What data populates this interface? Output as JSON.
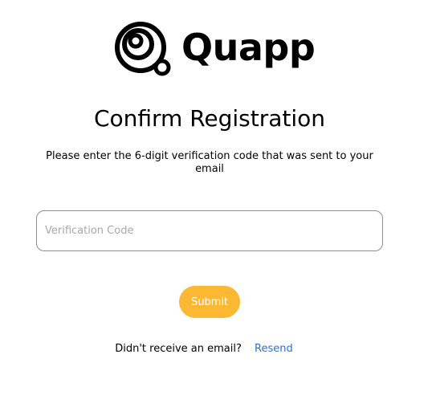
{
  "brand": {
    "name": "Quapp",
    "logo_icon": "quapp-logo-icon"
  },
  "heading": {
    "title": "Confirm Registration",
    "instructions": "Please enter the 6-digit verification code that was sent to your email"
  },
  "form": {
    "code_value": "",
    "code_placeholder": "Verification Code",
    "submit_label": "Submit"
  },
  "resend": {
    "prompt": "Didn't receive an email?",
    "link_label": "Resend"
  },
  "colors": {
    "submit_bg": "#fdb833",
    "link": "#2b6fd6",
    "input_border": "#8f8f8f"
  }
}
